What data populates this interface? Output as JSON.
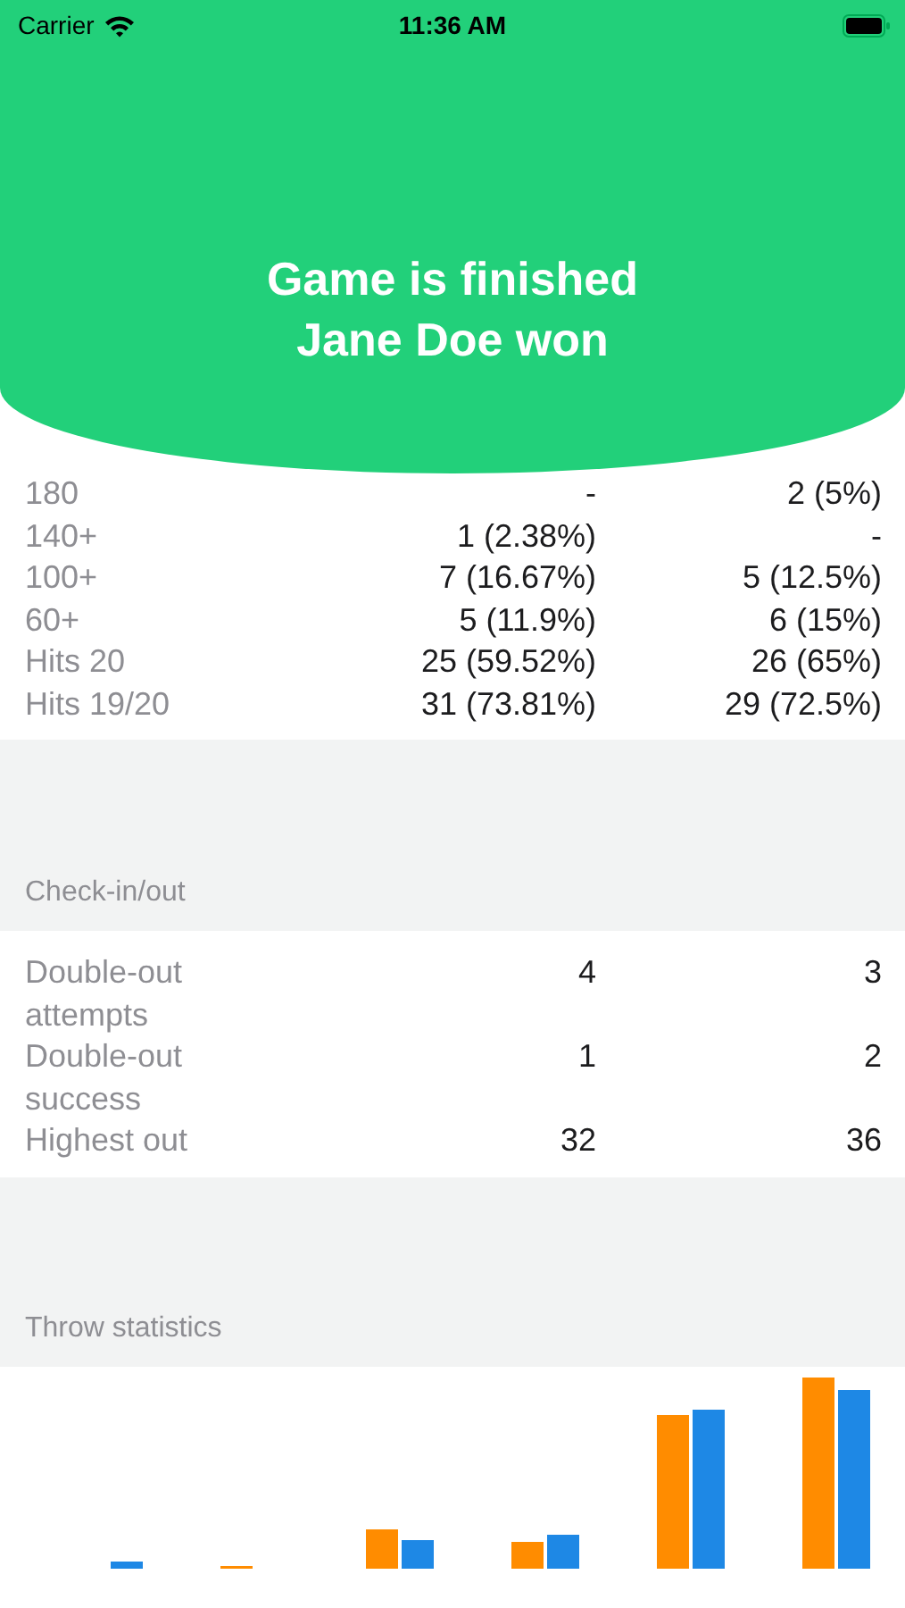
{
  "status_bar": {
    "carrier": "Carrier",
    "time": "11:36 AM"
  },
  "header": {
    "lines": [
      "Game is finished",
      "Jane Doe won"
    ]
  },
  "score_rows": [
    {
      "label": "180",
      "player_1": "-",
      "player_2": "2 (5%)"
    },
    {
      "label": "140+",
      "player_1": "1 (2.38%)",
      "player_2": "-"
    },
    {
      "label": "100+",
      "player_1": "7 (16.67%)",
      "player_2": "5 (12.5%)"
    },
    {
      "label": "60+",
      "player_1": "5 (11.9%)",
      "player_2": "6 (15%)"
    },
    {
      "label": "Hits 20",
      "player_1": "25 (59.52%)",
      "player_2": "26 (65%)"
    },
    {
      "label": "Hits 19/20",
      "player_1": "31 (73.81%)",
      "player_2": "29 (72.5%)"
    }
  ],
  "checkout_section": {
    "title": "Check-in/out",
    "rows": [
      {
        "label": "Double-out attempts",
        "player_1": "4",
        "player_2": "3"
      },
      {
        "label": "Double-out success",
        "player_1": "1",
        "player_2": "2"
      },
      {
        "label": "Highest out",
        "player_1": "32",
        "player_2": "36"
      }
    ]
  },
  "throw_section": {
    "title": "Throw statistics"
  }
}
